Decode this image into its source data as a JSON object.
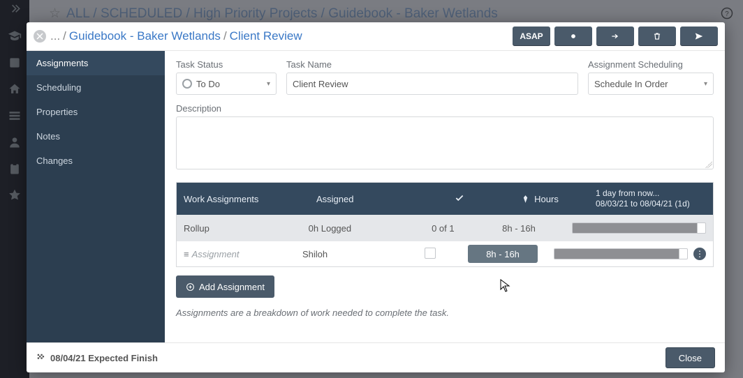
{
  "back_breadcrumb": "ALL / SCHEDULED / High Priority Projects / Guidebook - Baker Wetlands",
  "breadcrumb": {
    "dots": "...",
    "mid": "Guidebook - Baker Wetlands",
    "leaf": "Client Review"
  },
  "toolbar": {
    "asap": "ASAP"
  },
  "sidebar": {
    "tabs": [
      "Assignments",
      "Scheduling",
      "Properties",
      "Notes",
      "Changes"
    ]
  },
  "fields": {
    "status_label": "Task Status",
    "status_value": "To Do",
    "name_label": "Task Name",
    "name_value": "Client Review",
    "sched_label": "Assignment Scheduling",
    "sched_value": "Schedule In Order",
    "desc_label": "Description",
    "desc_value": ""
  },
  "wa": {
    "headers": {
      "name": "Work Assignments",
      "assigned": "Assigned",
      "hours": "Hours",
      "sched_line1": "1 day from now...",
      "sched_line2": "08/03/21 to 08/04/21 (1d)"
    },
    "rollup": {
      "label": "Rollup",
      "assigned": "0h Logged",
      "check": "0 of 1",
      "hours": "8h - 16h"
    },
    "rows": [
      {
        "label": "Assignment",
        "assigned": "Shiloh",
        "hours": "8h - 16h"
      }
    ],
    "add_label": "Add Assignment",
    "hint": "Assignments are a breakdown of work needed to complete the task."
  },
  "footer": {
    "finish": "08/04/21 Expected Finish",
    "close": "Close"
  }
}
